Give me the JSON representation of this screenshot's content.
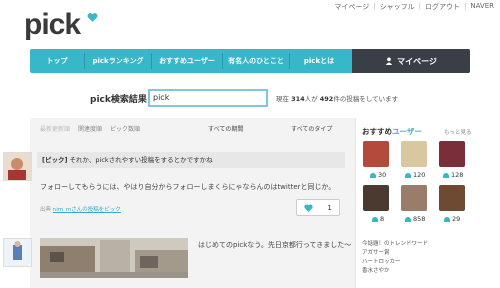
{
  "header": {
    "logo": "pick",
    "links": [
      "マイページ",
      "シャッフル",
      "ログアウト",
      "NAVER"
    ]
  },
  "nav": {
    "items": [
      "トップ",
      "pickランキング",
      "おすすめユーザー",
      "有名人のひとこと",
      "pickとは"
    ],
    "mypage": "マイページ"
  },
  "search": {
    "label": "pick検索結果",
    "value": "pick",
    "result_prefix": "現在",
    "result_users": "314",
    "result_mid": "人が",
    "result_posts": "492",
    "result_suffix": "件の投稿をしています"
  },
  "filters": {
    "latest": "最新更新順",
    "relevance": "関連度順",
    "pick_count": "ピック数順",
    "period": "すべての期間",
    "type": "すべてのタイプ"
  },
  "post1": {
    "tag": "[ピック]",
    "title": " それか、pickされやすい投稿をするとかですかね",
    "body": "フォローしてもらうには、やはり自分からフォローしまくらにゃならんのはtwitterと同じか。",
    "meta_prefix": "出典",
    "meta_user": "nim_m",
    "meta_suffix": "さんの投稿をピック",
    "likes": "1"
  },
  "post2": {
    "text": "はじめてのpickなう。先日京都行ってきました～"
  },
  "sidebar": {
    "title_black": "おすすめ",
    "title_blue": "ユーザー",
    "more": "もっと見る",
    "users": [
      {
        "count": "30",
        "color": "#b34a3c"
      },
      {
        "count": "120",
        "color": "#d9c7a0"
      },
      {
        "count": "128",
        "color": "#7a2e3a"
      },
      {
        "count": "8",
        "color": "#4a3a30"
      },
      {
        "count": "858",
        "color": "#9a7c6a"
      },
      {
        "count": "29",
        "color": "#6e4a33"
      }
    ],
    "trends": [
      "今話題！のトレンドワード",
      "アガサー賞",
      "ハートロッカー",
      "香水さやか"
    ]
  }
}
